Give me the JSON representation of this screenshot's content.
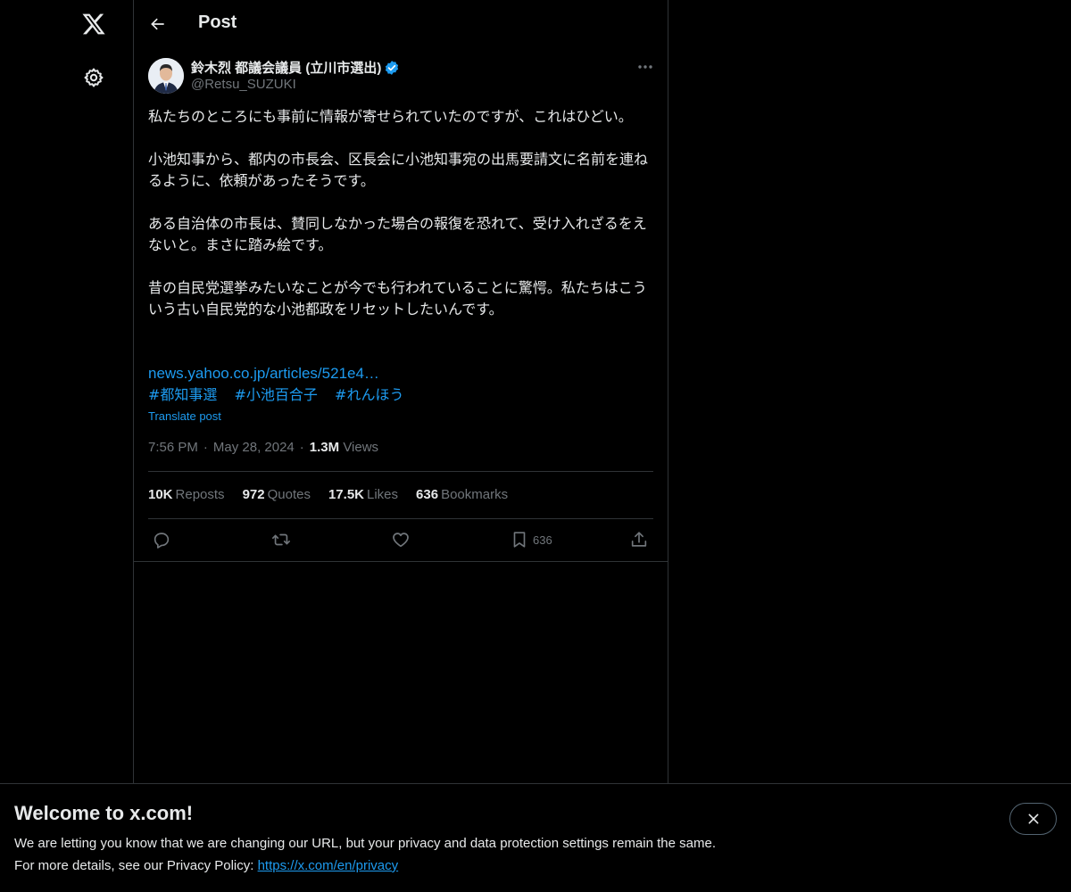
{
  "header": {
    "title": "Post"
  },
  "author": {
    "name": "鈴木烈 都議会議員 (立川市選出)",
    "handle": "@Retsu_SUZUKI"
  },
  "tweet": {
    "paragraphs": [
      "私たちのところにも事前に情報が寄せられていたのですが、これはひどい。",
      "小池知事から、都内の市長会、区長会に小池知事宛の出馬要請文に名前を連ねるように、依頼があったそうです。",
      "ある自治体の市長は、賛同しなかった場合の報復を恐れて、受け入れざるをえないと。まさに踏み絵です。",
      "昔の自民党選挙みたいなことが今でも行われていることに驚愕。私たちはこういう古い自民党的な小池都政をリセットしたいんです。"
    ],
    "link": "news.yahoo.co.jp/articles/521e4…",
    "hashtags": [
      "#都知事選",
      "#小池百合子",
      "#れんほう"
    ],
    "translate_label": "Translate post"
  },
  "meta": {
    "time": "7:56 PM",
    "date": "May 28, 2024",
    "views_count": "1.3M",
    "views_label": "Views"
  },
  "stats": {
    "reposts_count": "10K",
    "reposts_label": "Reposts",
    "quotes_count": "972",
    "quotes_label": "Quotes",
    "likes_count": "17.5K",
    "likes_label": "Likes",
    "bookmarks_count": "636",
    "bookmarks_label": "Bookmarks"
  },
  "actions": {
    "bookmark_count": "636"
  },
  "banner": {
    "title": "Welcome to x.com!",
    "line1": "We are letting you know that we are changing our URL, but your privacy and data protection settings remain the same.",
    "line2_prefix": "For more details, see our Privacy Policy: ",
    "link": "https://x.com/en/privacy"
  },
  "icons": {
    "logo": "x-logo-icon",
    "settings": "gear-icon",
    "back": "arrow-left-icon",
    "verified": "verified-badge-icon",
    "more": "more-horizontal-icon",
    "reply": "reply-icon",
    "repost": "repost-icon",
    "like": "heart-icon",
    "bookmark": "bookmark-icon",
    "share": "share-icon",
    "close": "close-icon"
  },
  "colors": {
    "background": "#000000",
    "text": "#e7e9ea",
    "muted": "#71767b",
    "accent": "#1d9bf0",
    "border": "#2f3336"
  }
}
